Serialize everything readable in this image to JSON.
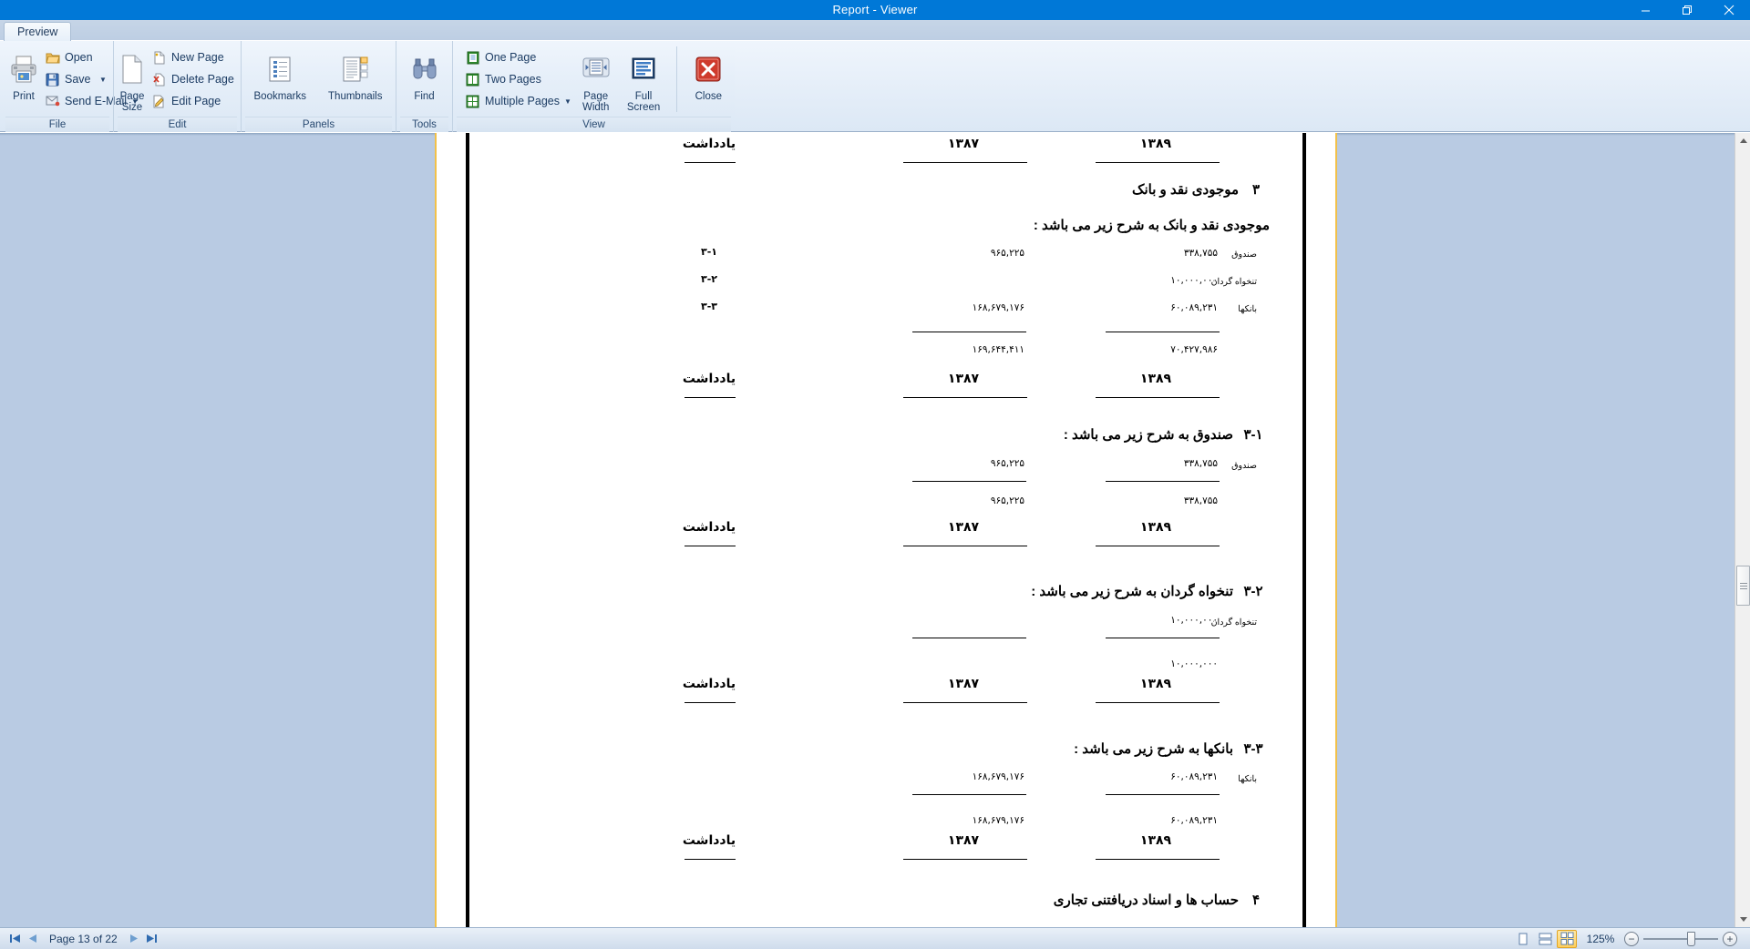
{
  "window": {
    "title": "Report - Viewer",
    "minimize_label": "minimize",
    "restore_label": "restore",
    "close_label": "close"
  },
  "ribbon": {
    "tabs": [
      {
        "label": "Preview"
      }
    ],
    "groups": [
      {
        "label": "File",
        "big": [
          {
            "label": "Print",
            "icon": "printer-icon"
          }
        ],
        "small": [
          {
            "label": "Open",
            "icon": "folder-open-icon",
            "caret": false
          },
          {
            "label": "Save",
            "icon": "floppy-disk-icon",
            "caret": true
          },
          {
            "label": "Send E-Mail",
            "icon": "envelope-icon",
            "caret": true
          }
        ]
      },
      {
        "label": "Edit",
        "big": [
          {
            "label": "Page Size",
            "icon": "page-size-icon"
          }
        ],
        "small": [
          {
            "label": "New Page",
            "icon": "new-page-icon",
            "caret": false
          },
          {
            "label": "Delete Page",
            "icon": "delete-page-icon",
            "caret": false
          },
          {
            "label": "Edit Page",
            "icon": "edit-page-icon",
            "caret": false
          }
        ]
      },
      {
        "label": "Panels",
        "big": [
          {
            "label": "Bookmarks",
            "icon": "bookmarks-icon"
          },
          {
            "label": "Thumbnails",
            "icon": "thumbnails-icon"
          }
        ],
        "small": []
      },
      {
        "label": "Tools",
        "big": [
          {
            "label": "Find",
            "icon": "binoculars-icon"
          }
        ],
        "small": []
      },
      {
        "label": "View",
        "big": [
          {
            "label": "Page Width",
            "icon": "page-width-icon"
          },
          {
            "label": "Full Screen",
            "icon": "full-screen-icon"
          },
          {
            "label": "Close",
            "icon": "close-red-x-icon"
          }
        ],
        "small": [
          {
            "label": "One Page",
            "icon": "one-page-icon",
            "caret": false
          },
          {
            "label": "Two Pages",
            "icon": "two-pages-icon",
            "caret": false
          },
          {
            "label": "Multiple Pages",
            "icon": "multiple-pages-icon",
            "caret": true
          }
        ]
      }
    ]
  },
  "document": {
    "columns": {
      "note": "یادداشت",
      "year_current": "۱۳۸۹",
      "year_prior": "۱۳۸۷"
    },
    "sections": [
      {
        "number": "۳",
        "title": "موجودی نقد و بانک",
        "intro": "موجودی نقد و بانک به شرح زیر می باشد :",
        "rows": [
          {
            "label": "صندوق",
            "note": "۳-۱",
            "y1389": "۳۳۸,۷۵۵",
            "y1387": "۹۶۵,۲۲۵"
          },
          {
            "label": "تنخواه گردان",
            "note": "۳-۲",
            "y1389": "۱۰,۰۰۰,۰۰۰",
            "y1387": ""
          },
          {
            "label": "بانکها",
            "note": "۳-۳",
            "y1389": "۶۰,۰۸۹,۲۳۱",
            "y1387": "۱۶۸,۶۷۹,۱۷۶"
          }
        ],
        "total": {
          "y1389": "۷۰,۴۲۷,۹۸۶",
          "y1387": "۱۶۹,۶۴۴,۴۱۱"
        }
      },
      {
        "number": "۳-۱",
        "title": "صندوق به شرح زیر می باشد :",
        "rows": [
          {
            "label": "صندوق",
            "note": "",
            "y1389": "۳۳۸,۷۵۵",
            "y1387": "۹۶۵,۲۲۵"
          }
        ],
        "total": {
          "y1389": "۳۳۸,۷۵۵",
          "y1387": "۹۶۵,۲۲۵"
        }
      },
      {
        "number": "۳-۲",
        "title": "تنخواه گردان به شرح زیر می باشد :",
        "rows": [
          {
            "label": "تنخواه گردان",
            "note": "",
            "y1389": "۱۰,۰۰۰,۰۰۰",
            "y1387": ""
          }
        ],
        "total": {
          "y1389": "۱۰,۰۰۰,۰۰۰",
          "y1387": ""
        }
      },
      {
        "number": "۳-۳",
        "title": "بانکها به شرح زیر می باشد :",
        "rows": [
          {
            "label": "بانکها",
            "note": "",
            "y1389": "۶۰,۰۸۹,۲۳۱",
            "y1387": "۱۶۸,۶۷۹,۱۷۶"
          }
        ],
        "total": {
          "y1389": "۶۰,۰۸۹,۲۳۱",
          "y1387": "۱۶۸,۶۷۹,۱۷۶"
        }
      },
      {
        "number": "۴",
        "title": "حساب ها و اسناد دریافتنی تجاری",
        "rows": [],
        "total": null
      }
    ]
  },
  "statusbar": {
    "first_label": "first page",
    "prev_label": "previous page",
    "next_label": "next page",
    "last_label": "last page",
    "page_text": "Page 13 of 22",
    "view_modes": [
      {
        "name": "single-page-view",
        "active": false
      },
      {
        "name": "facing-page-view",
        "active": false
      },
      {
        "name": "tiled-page-view",
        "active": true
      }
    ],
    "zoom_level": "125%",
    "zoom_out_label": "−",
    "zoom_in_label": "+"
  },
  "colors": {
    "titlebar": "#0078d7",
    "page_border": "#f2c14a",
    "viewer_bg": "#b9cbe3",
    "accent": "#2f6bb0"
  }
}
